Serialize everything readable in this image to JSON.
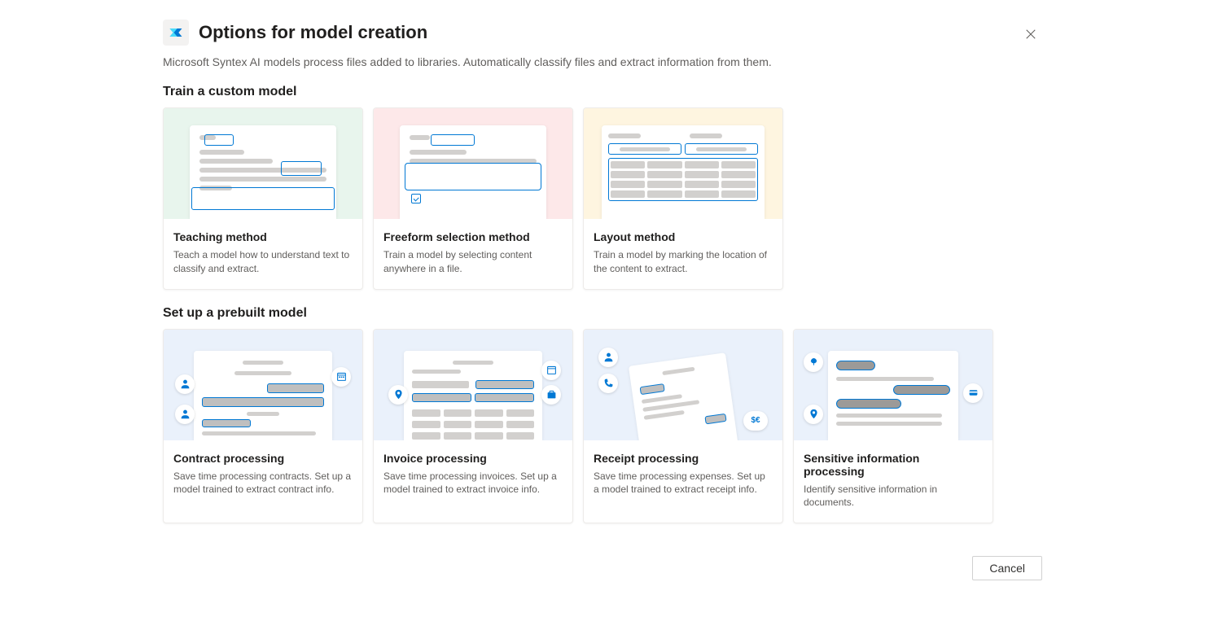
{
  "dialog": {
    "title": "Options for model creation",
    "subtitle": "Microsoft Syntex AI models process files added to libraries. Automatically classify files and extract information from them."
  },
  "sections": {
    "custom": {
      "title": "Train a custom model",
      "cards": [
        {
          "title": "Teaching method",
          "desc": "Teach a model how to understand text to classify and extract."
        },
        {
          "title": "Freeform selection method",
          "desc": "Train a model by selecting content anywhere in a file."
        },
        {
          "title": "Layout method",
          "desc": "Train a model by marking the location of the content to extract."
        }
      ]
    },
    "prebuilt": {
      "title": "Set up a prebuilt model",
      "cards": [
        {
          "title": "Contract processing",
          "desc": "Save time processing contracts. Set up a model trained to extract contract info."
        },
        {
          "title": "Invoice processing",
          "desc": "Save time processing invoices. Set up a model trained to extract invoice info."
        },
        {
          "title": "Receipt processing",
          "desc": "Save time processing expenses. Set up a model trained to extract receipt info."
        },
        {
          "title": "Sensitive information processing",
          "desc": "Identify sensitive information in documents."
        }
      ]
    }
  },
  "buttons": {
    "cancel": "Cancel"
  }
}
